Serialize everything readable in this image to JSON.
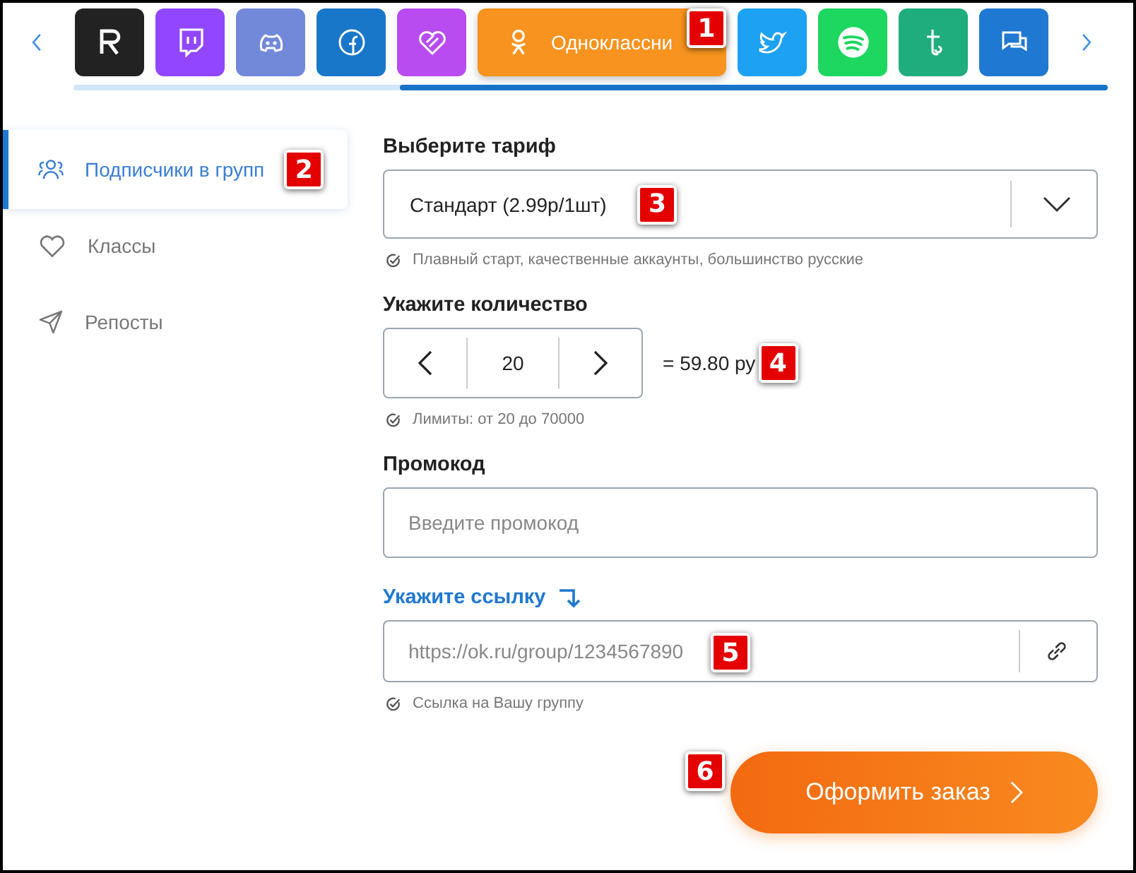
{
  "platforms": [
    {
      "kind": "rutube",
      "color": "#222222",
      "selected": false
    },
    {
      "kind": "twitch",
      "color": "#9146ff",
      "selected": false
    },
    {
      "kind": "discord",
      "color": "#7289da",
      "selected": false
    },
    {
      "kind": "facebook",
      "color": "#1877c9",
      "selected": false
    },
    {
      "kind": "likee",
      "color": "#b84cf0",
      "selected": false
    },
    {
      "kind": "odnoklassniki",
      "color": "#f7931e",
      "selected": true,
      "label": "Одноклассни"
    },
    {
      "kind": "twitter",
      "color": "#1da1f2",
      "selected": false
    },
    {
      "kind": "spotify",
      "color": "#1ed760",
      "selected": false
    },
    {
      "kind": "tumblr",
      "color": "#1fad7e",
      "selected": false
    },
    {
      "kind": "chat",
      "color": "#1f78d1",
      "selected": false
    }
  ],
  "sidebar": {
    "items": [
      {
        "kind": "subscribers",
        "label": "Подписчики в групп",
        "selected": true
      },
      {
        "kind": "likes",
        "label": "Классы",
        "selected": false
      },
      {
        "kind": "reposts",
        "label": "Репосты",
        "selected": false
      }
    ]
  },
  "form": {
    "tariff": {
      "label": "Выберите тариф",
      "value": "Стандарт (2.99р/1шт)",
      "hint": "Плавный старт, качественные аккаунты, большинство русские"
    },
    "quantity": {
      "label": "Укажите количество",
      "value": "20",
      "total": "= 59.80 ру",
      "hint": "Лимиты: от 20 до 70000"
    },
    "promo": {
      "label": "Промокод",
      "placeholder": "Введите промокод"
    },
    "link": {
      "label": "Укажите ссылку",
      "placeholder": "https://ok.ru/group/1234567890",
      "hint": "Ссылка на Вашу группу"
    },
    "submit": "Оформить заказ"
  },
  "callouts": [
    "1",
    "2",
    "3",
    "4",
    "5",
    "6"
  ]
}
